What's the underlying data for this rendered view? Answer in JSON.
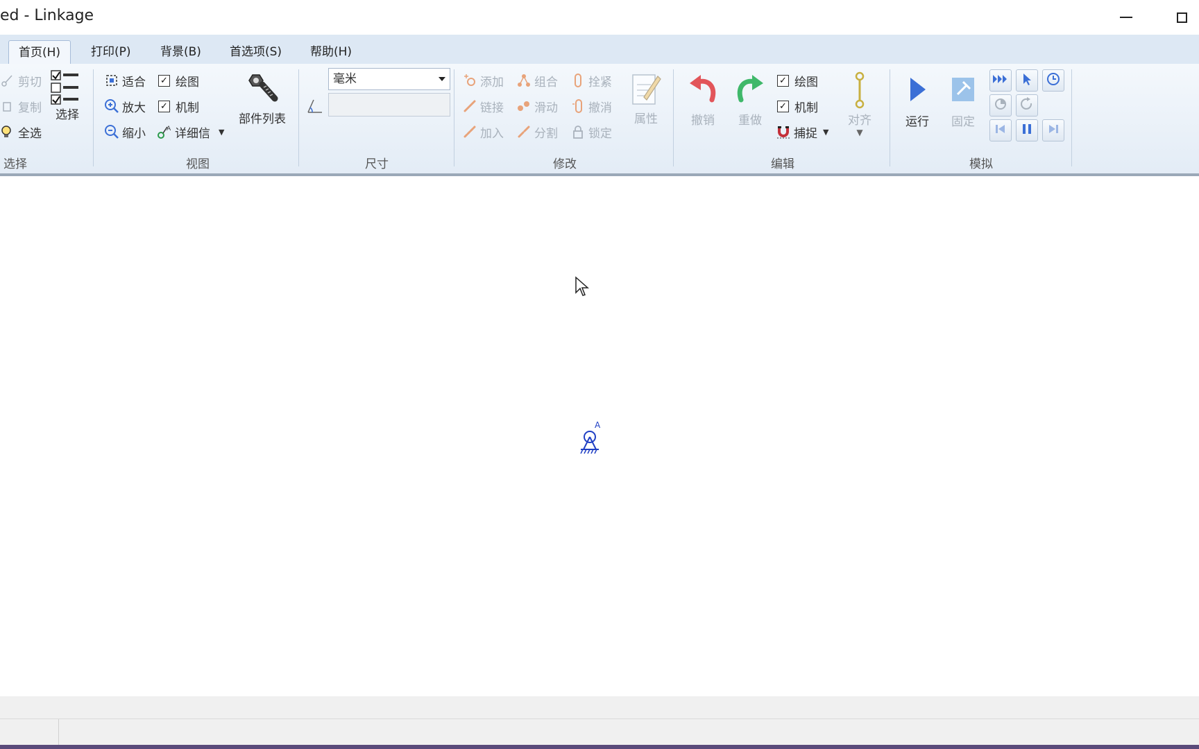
{
  "window": {
    "title": "ed - Linkage"
  },
  "tabs": [
    {
      "label": "首页(H)",
      "active": true
    },
    {
      "label": "打印(P)",
      "active": false
    },
    {
      "label": "背景(B)",
      "active": false
    },
    {
      "label": "首选项(S)",
      "active": false
    },
    {
      "label": "帮助(H)",
      "active": false
    }
  ],
  "groups": {
    "select": {
      "label": "选择",
      "cut": "剪切",
      "copy": "复制",
      "select_all": "全选",
      "select_btn": "选择"
    },
    "view": {
      "label": "视图",
      "fit": "适合",
      "zoom_in": "放大",
      "zoom_out": "缩小",
      "drawing": "绘图",
      "mechanism": "机制",
      "details": "详细信",
      "parts_list": "部件列表"
    },
    "dimension": {
      "label": "尺寸",
      "unit": "毫米",
      "value": ""
    },
    "modify": {
      "label": "修改",
      "add": "添加",
      "link": "链接",
      "insert": "加入",
      "combine": "组合",
      "slide": "滑动",
      "split": "分割",
      "fasten": "拴紧",
      "unfasten": "撤消",
      "lock": "锁定",
      "properties": "属性"
    },
    "edit": {
      "label": "编辑",
      "undo": "撤销",
      "redo": "重做",
      "drawing": "绘图",
      "mechanism": "机制",
      "snap": "捕捉",
      "align": "对齐"
    },
    "simulate": {
      "label": "模拟",
      "run": "运行",
      "pin": "固定"
    }
  },
  "canvas": {
    "anchor_label": "A"
  },
  "colors": {
    "accent_blue": "#3b6fd6",
    "undo_red": "#e2555a",
    "redo_green": "#3fb86a",
    "disabled": "#a9b2bc",
    "mechanism_blue": "#1f3fc4"
  }
}
